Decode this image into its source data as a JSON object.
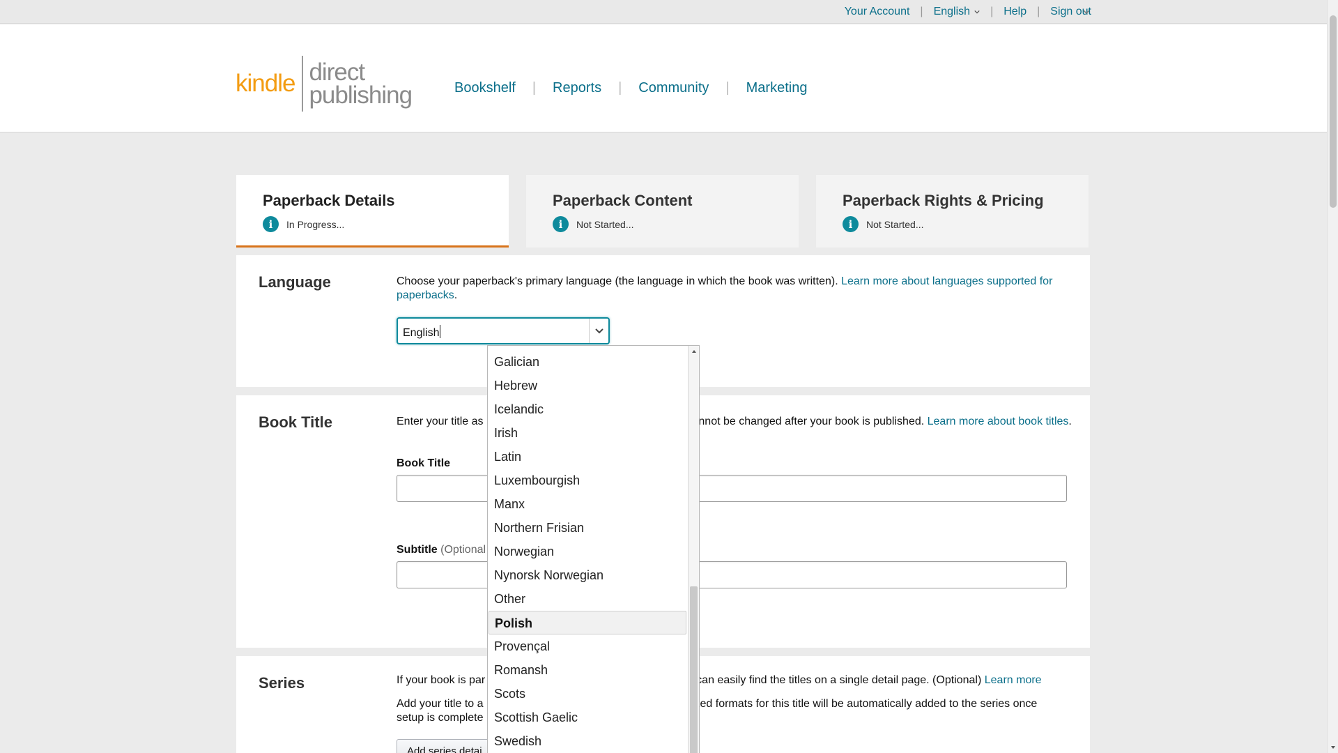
{
  "topbar": {
    "links": [
      {
        "label": "Your Account"
      },
      {
        "label": "English"
      },
      {
        "label": "Help"
      },
      {
        "label": "Sign out"
      }
    ],
    "separator": "|"
  },
  "header": {
    "logo_kindle": "kindle",
    "logo_direct": "direct",
    "logo_publishing": "publishing",
    "nav": [
      {
        "label": "Bookshelf"
      },
      {
        "label": "Reports"
      },
      {
        "label": "Community"
      },
      {
        "label": "Marketing"
      }
    ]
  },
  "tabs": [
    {
      "title": "Paperback Details",
      "status": "In Progress..."
    },
    {
      "title": "Paperback Content",
      "status": "Not Started..."
    },
    {
      "title": "Paperback Rights & Pricing",
      "status": "Not Started..."
    }
  ],
  "language": {
    "title": "Language",
    "desc": "Choose your paperback's primary language (the language in which the book was written). ",
    "link": "Learn more about languages supported for paperbacks",
    "desc_end": ".",
    "select_value": "English",
    "options": [
      "Galician",
      "Hebrew",
      "Icelandic",
      "Irish",
      "Latin",
      "Luxembourgish",
      "Manx",
      "Northern Frisian",
      "Norwegian",
      "Nynorsk Norwegian",
      "Other",
      "Polish",
      "Provençal",
      "Romansh",
      "Scots",
      "Scottish Gaelic",
      "Swedish"
    ],
    "selected_option": "Polish"
  },
  "book_title": {
    "title": "Book Title",
    "desc_start": "Enter your title as",
    "desc_mid": "annot be changed after your book is published. ",
    "link": "Learn more about book titles",
    "desc_end": ".",
    "title_label": "Book Title",
    "subtitle_label": "Subtitle",
    "subtitle_opt": "(Optional"
  },
  "series": {
    "title": "Series",
    "desc1_start": "If your book is par",
    "desc1_mid": "can easily find the titles on a single detail page. (Optional) ",
    "desc1_link": "Learn more",
    "desc2_start": "Add your title to a",
    "desc2_mid": "ked formats for this title will be automatically added to the series once",
    "desc2_line2": "setup is complete",
    "button": "Add series detai"
  },
  "colors": {
    "accent": "#0b6f8a",
    "tab_underline": "#d8731a",
    "kindle_orange": "#f39c12",
    "info": "#0e8a9c"
  }
}
